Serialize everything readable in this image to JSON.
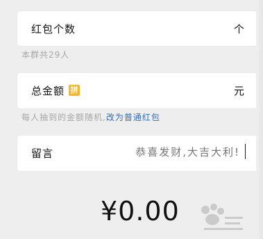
{
  "form": {
    "count": {
      "label": "红包个数",
      "unit": "个"
    },
    "group_hint": "本群共29人",
    "total": {
      "label": "总金额",
      "badge": "拼",
      "unit": "元"
    },
    "random_hint": "每人抽到的金额随机,",
    "switch_link": "改为普通红包",
    "message": {
      "label": "留言",
      "placeholder": "恭喜发财,大吉大利!"
    },
    "amount": "¥0.00"
  },
  "colors": {
    "background": "#f0efef",
    "card": "#ffffff",
    "link": "#2f6ebc",
    "badge": "#f4b830",
    "hint": "#a6a6a6"
  },
  "icons": {
    "watermark": "baidu-jingyan-watermark-icon"
  }
}
